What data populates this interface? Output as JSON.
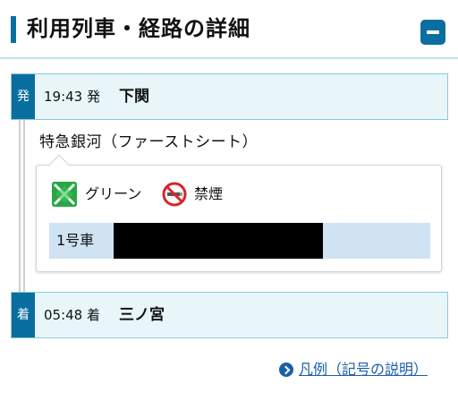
{
  "header": {
    "title": "利用列車・経路の詳細"
  },
  "departure": {
    "tag": "発",
    "time": "19:43 発",
    "station": "下関"
  },
  "train": {
    "name": "特急銀河（ファーストシート）",
    "features": [
      {
        "label": "グリーン",
        "icon": "green-car-icon",
        "color": "#28a745"
      },
      {
        "label": "禁煙",
        "icon": "no-smoking-icon",
        "color": "#d9242b"
      }
    ],
    "car": "1号車"
  },
  "arrival": {
    "tag": "着",
    "time": "05:48 着",
    "station": "三ノ宮"
  },
  "legend_link": {
    "label": "凡例（記号の説明）"
  },
  "colors": {
    "accent": "#0a6fa0",
    "row_bg": "#e8f6fa",
    "car_row_bg": "#cfe3f3",
    "link": "#1a5fa6"
  }
}
